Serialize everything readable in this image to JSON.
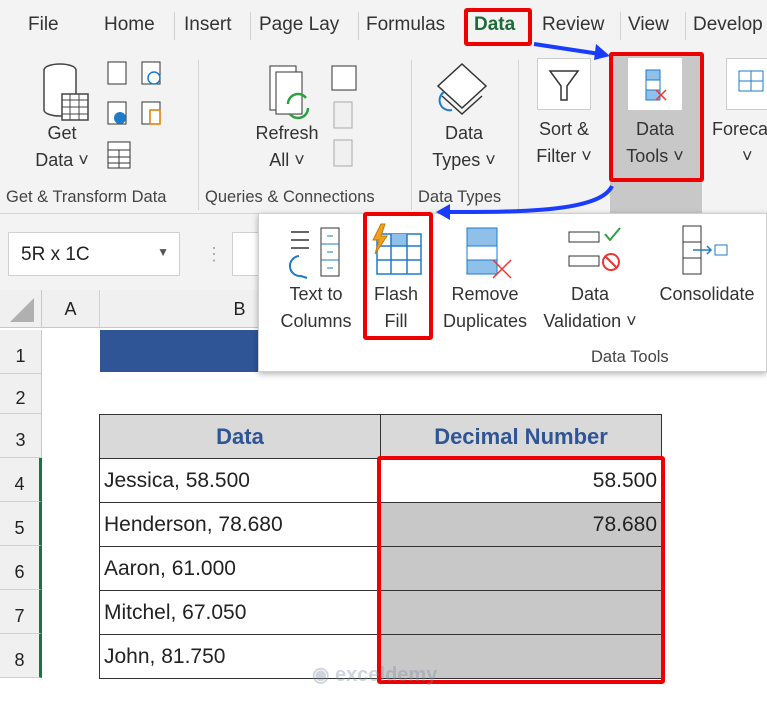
{
  "tabs": [
    "File",
    "Home",
    "Insert",
    "Page Lay",
    "Formulas",
    "Data",
    "Review",
    "View",
    "Develop"
  ],
  "ribbon": {
    "get_data": [
      "Get",
      "Data ˅"
    ],
    "refresh": [
      "Refresh",
      "All ˅"
    ],
    "data_types": [
      "Data",
      "Types ˅"
    ],
    "sort_filter": [
      "Sort &",
      "Filter ˅"
    ],
    "data_tools": [
      "Data",
      "Tools ˅"
    ],
    "forecast": [
      "Foreca",
      "˅"
    ],
    "groups": [
      "Get & Transform Data",
      "Queries & Connections",
      "Data Types"
    ]
  },
  "namebox": {
    "value": "5R x 1C"
  },
  "popup": {
    "text_to_columns": [
      "Text to",
      "Columns"
    ],
    "flash_fill": [
      "Flash",
      "Fill"
    ],
    "remove_duplicates": [
      "Remove",
      "Duplicates"
    ],
    "data_validation": [
      "Data",
      "Validation ˅"
    ],
    "consolidate": "Consolidate",
    "group_label": "Data Tools"
  },
  "columns": [
    "A",
    "B"
  ],
  "rows": [
    "1",
    "2",
    "3",
    "4",
    "5",
    "6",
    "7",
    "8"
  ],
  "table": {
    "headers": [
      "Data",
      "Decimal Number"
    ],
    "rows": [
      [
        "Jessica, 58.500",
        "58.500"
      ],
      [
        "Henderson, 78.680",
        "78.680"
      ],
      [
        "Aaron, 61.000",
        ""
      ],
      [
        "Mitchel, 67.050",
        ""
      ],
      [
        "John, 81.750",
        ""
      ]
    ]
  },
  "watermark": "exceldemy",
  "colors": {
    "accent_red": "#e00000",
    "arrow_blue": "#1a3cff",
    "header_blue": "#2f5597",
    "selection_gray": "#c8c8c8"
  }
}
